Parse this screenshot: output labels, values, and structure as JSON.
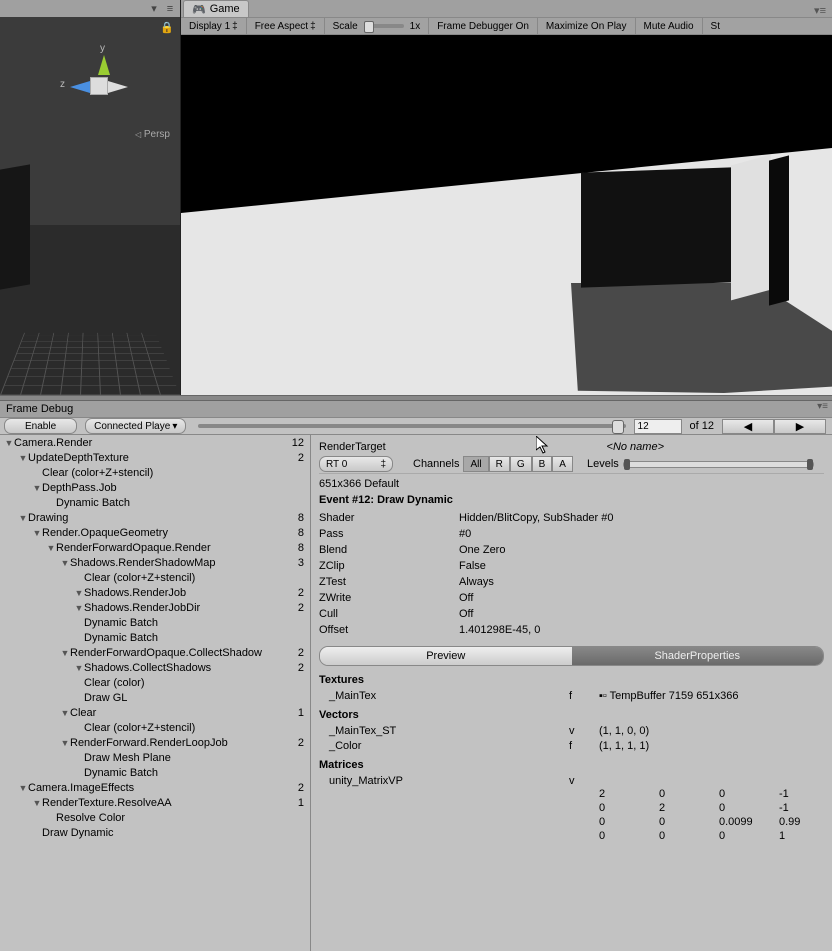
{
  "scene": {
    "persp": "Persp",
    "axis_y": "y",
    "axis_z": "z"
  },
  "game": {
    "tab": "Game",
    "toolbar": {
      "display": "Display 1",
      "aspect": "Free Aspect",
      "scale_label": "Scale",
      "scale_val": "1x",
      "frame_debugger": "Frame Debugger On",
      "maximize": "Maximize On Play",
      "mute": "Mute Audio",
      "st": "St"
    }
  },
  "frame_debug": {
    "title": "Frame Debug",
    "enable": "Enable",
    "connected": "Connected Playe",
    "step_value": "12",
    "of": "of 12",
    "render_target": {
      "label": "RenderTarget",
      "value": "<No name>"
    },
    "rt_select": "RT 0",
    "channels_label": "Channels",
    "channels": [
      "All",
      "R",
      "G",
      "B",
      "A"
    ],
    "levels": "Levels",
    "resolution": "651x366 Default",
    "event_title": "Event #12: Draw Dynamic",
    "details": [
      {
        "k": "Shader",
        "v": "Hidden/BlitCopy, SubShader #0"
      },
      {
        "k": "Pass",
        "v": "#0"
      },
      {
        "k": "Blend",
        "v": "One Zero"
      },
      {
        "k": "ZClip",
        "v": "False"
      },
      {
        "k": "ZTest",
        "v": "Always"
      },
      {
        "k": "ZWrite",
        "v": "Off"
      },
      {
        "k": "Cull",
        "v": "Off"
      },
      {
        "k": "Offset",
        "v": "1.401298E-45, 0"
      }
    ],
    "prop_tabs": {
      "preview": "Preview",
      "shader": "ShaderProperties"
    },
    "textures": {
      "h": "Textures",
      "items": [
        {
          "k": "_MainTex",
          "t": "f",
          "v": "TempBuffer 7159 651x366"
        }
      ]
    },
    "vectors": {
      "h": "Vectors",
      "items": [
        {
          "k": "_MainTex_ST",
          "t": "v",
          "v": "(1, 1, 0, 0)"
        },
        {
          "k": "_Color",
          "t": "f",
          "v": "(1, 1, 1, 1)"
        }
      ]
    },
    "matrices": {
      "h": "Matrices",
      "name": "unity_MatrixVP",
      "t": "v",
      "rows": [
        [
          "2",
          "0",
          "0",
          "-1"
        ],
        [
          "0",
          "2",
          "0",
          "-1"
        ],
        [
          "0",
          "0",
          "0.0099",
          "0.99"
        ],
        [
          "0",
          "0",
          "0",
          "1"
        ]
      ]
    },
    "tree": [
      {
        "d": 0,
        "a": "▼",
        "l": "Camera.Render",
        "c": "12"
      },
      {
        "d": 1,
        "a": "▼",
        "l": "UpdateDepthTexture",
        "c": "2"
      },
      {
        "d": 2,
        "a": "",
        "l": "Clear (color+Z+stencil)",
        "c": ""
      },
      {
        "d": 2,
        "a": "▼",
        "l": "DepthPass.Job",
        "c": ""
      },
      {
        "d": 3,
        "a": "",
        "l": "Dynamic Batch",
        "c": ""
      },
      {
        "d": 1,
        "a": "▼",
        "l": "Drawing",
        "c": "8"
      },
      {
        "d": 2,
        "a": "▼",
        "l": "Render.OpaqueGeometry",
        "c": "8"
      },
      {
        "d": 3,
        "a": "▼",
        "l": "RenderForwardOpaque.Render",
        "c": "8"
      },
      {
        "d": 4,
        "a": "▼",
        "l": "Shadows.RenderShadowMap",
        "c": "3"
      },
      {
        "d": 5,
        "a": "",
        "l": "Clear (color+Z+stencil)",
        "c": ""
      },
      {
        "d": 5,
        "a": "▼",
        "l": "Shadows.RenderJob",
        "c": "2"
      },
      {
        "d": 5,
        "a": "▼",
        "l": " Shadows.RenderJobDir",
        "c": "2"
      },
      {
        "d": 5,
        "a": "",
        "l": "  Dynamic Batch",
        "c": ""
      },
      {
        "d": 5,
        "a": "",
        "l": "  Dynamic Batch",
        "c": ""
      },
      {
        "d": 4,
        "a": "▼",
        "l": "RenderForwardOpaque.CollectShadow",
        "c": "2"
      },
      {
        "d": 5,
        "a": "▼",
        "l": "Shadows.CollectShadows",
        "c": "2"
      },
      {
        "d": 5,
        "a": "",
        "l": " Clear (color)",
        "c": ""
      },
      {
        "d": 5,
        "a": "",
        "l": " Draw GL",
        "c": ""
      },
      {
        "d": 4,
        "a": "▼",
        "l": "Clear",
        "c": "1"
      },
      {
        "d": 5,
        "a": "",
        "l": "Clear (color+Z+stencil)",
        "c": ""
      },
      {
        "d": 4,
        "a": "▼",
        "l": "RenderForward.RenderLoopJob",
        "c": "2"
      },
      {
        "d": 5,
        "a": "",
        "l": "Draw Mesh Plane",
        "c": ""
      },
      {
        "d": 5,
        "a": "",
        "l": "Dynamic Batch",
        "c": ""
      },
      {
        "d": 1,
        "a": "▼",
        "l": "Camera.ImageEffects",
        "c": "2"
      },
      {
        "d": 2,
        "a": "▼",
        "l": "RenderTexture.ResolveAA",
        "c": "1"
      },
      {
        "d": 3,
        "a": "",
        "l": "Resolve Color",
        "c": ""
      },
      {
        "d": 2,
        "a": "",
        "l": "Draw Dynamic",
        "c": ""
      }
    ]
  }
}
